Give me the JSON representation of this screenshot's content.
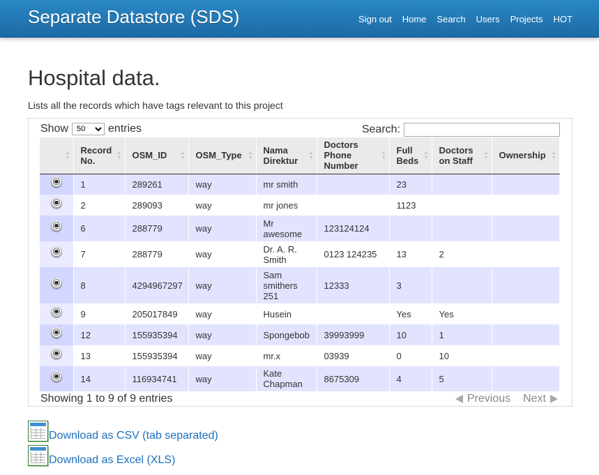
{
  "navbar": {
    "brand": "Separate Datastore (SDS)",
    "links": [
      "Sign out",
      "Home",
      "Search",
      "Users",
      "Projects",
      "HOT"
    ]
  },
  "page": {
    "title": "Hospital data.",
    "description": "Lists all the records which have tags relevant to this project"
  },
  "table_controls": {
    "show_label": "Show",
    "page_size": "50",
    "entries_label": "entries",
    "search_label": "Search:",
    "search_value": ""
  },
  "table": {
    "columns": [
      "",
      "Record No.",
      "OSM_ID",
      "OSM_Type",
      "Nama Direktur",
      "Doctors Phone Number",
      "Full Beds",
      "Doctors on Staff",
      "Ownership"
    ],
    "rows": [
      [
        "",
        "1",
        "289261",
        "way",
        "mr smith",
        "",
        "23",
        "",
        ""
      ],
      [
        "",
        "2",
        "289093",
        "way",
        "mr jones",
        "",
        "1123",
        "",
        ""
      ],
      [
        "",
        "6",
        "288779",
        "way",
        "Mr awesome",
        "123124124",
        "",
        "",
        ""
      ],
      [
        "",
        "7",
        "288779",
        "way",
        "Dr. A. R. Smith",
        "0123 124235",
        "13",
        "2",
        ""
      ],
      [
        "",
        "8",
        "4294967297",
        "way",
        "Sam smithers 251",
        "12333",
        "3",
        "",
        ""
      ],
      [
        "",
        "9",
        "205017849",
        "way",
        "Husein",
        "",
        "Yes",
        "Yes",
        ""
      ],
      [
        "",
        "12",
        "155935394",
        "way",
        "Spongebob",
        "39993999",
        "10",
        "1",
        ""
      ],
      [
        "",
        "13",
        "155935394",
        "way",
        "mr.x",
        "03939",
        "0",
        "10",
        ""
      ],
      [
        "",
        "14",
        "116934741",
        "way",
        "Kate Chapman",
        "8675309",
        "4",
        "5",
        ""
      ]
    ],
    "row_icon": "view-eye-icon",
    "info": "Showing 1 to 9 of 9 entries",
    "previous_label": "Previous",
    "next_label": "Next"
  },
  "downloads": [
    {
      "label": "Download as CSV (tab separated)",
      "icon": "spreadsheet-icon"
    },
    {
      "label": "Download as Excel (XLS)",
      "icon": "spreadsheet-icon"
    }
  ],
  "colors": {
    "navbar": "#1f72ae",
    "row_odd": "#e2e4ff",
    "row_even": "#ffffff",
    "link": "#1a6fbf"
  }
}
